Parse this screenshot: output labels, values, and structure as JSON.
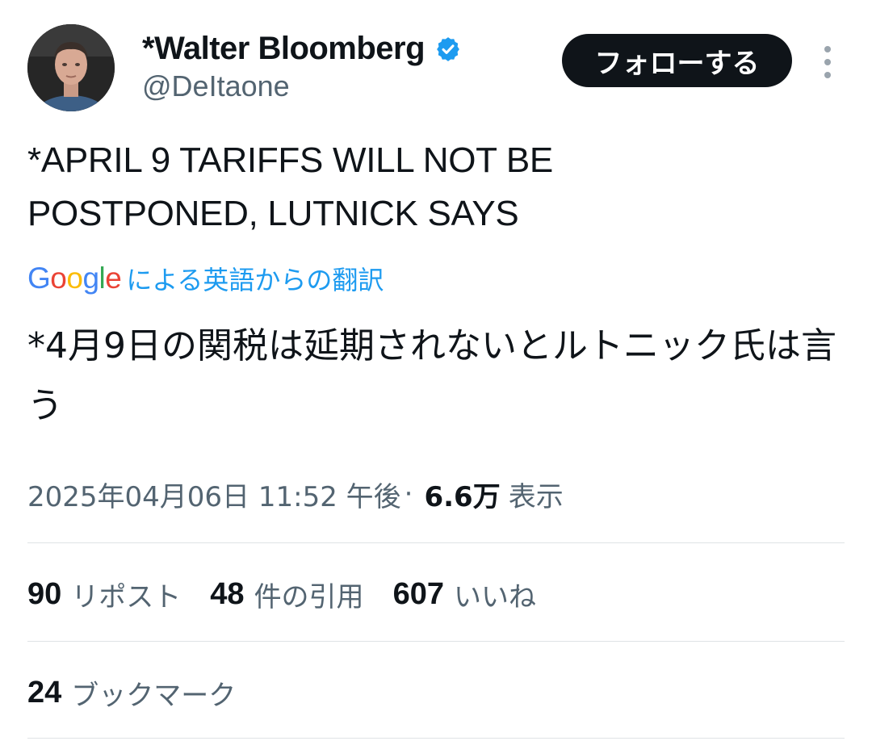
{
  "author": {
    "display_name": "*Walter Bloomberg",
    "handle": "@DeItaone",
    "verified": true,
    "verified_icon": "verified-badge-icon",
    "verified_color": "#1d9bf0"
  },
  "header": {
    "follow_label": "フォローする",
    "more_icon": "more-vertical-icon"
  },
  "tweet": {
    "text": "*APRIL 9 TARIFFS WILL NOT BE\nPOSTPONED, LUTNICK SAYS",
    "translation": {
      "provider_logo": [
        "G",
        "o",
        "o",
        "g",
        "l",
        "e"
      ],
      "label": "による英語からの翻訳",
      "text": "*4月9日の関税は延期されないとルトニック氏は言う"
    }
  },
  "meta": {
    "timestamp": "2025年04月06日 11:52 午後",
    "separator": "·",
    "views_count": "6.6万",
    "views_label": "表示"
  },
  "stats": {
    "reposts": {
      "count": "90",
      "label": "リポスト"
    },
    "quotes": {
      "count": "48",
      "label": "件の引用"
    },
    "likes": {
      "count": "607",
      "label": "いいね"
    },
    "bookmarks": {
      "count": "24",
      "label": "ブックマーク"
    }
  },
  "colors": {
    "text_primary": "#0f1419",
    "text_secondary": "#536471",
    "accent": "#1d9bf0",
    "follow_bg": "#0f1419",
    "divider": "#dfe3e6"
  }
}
